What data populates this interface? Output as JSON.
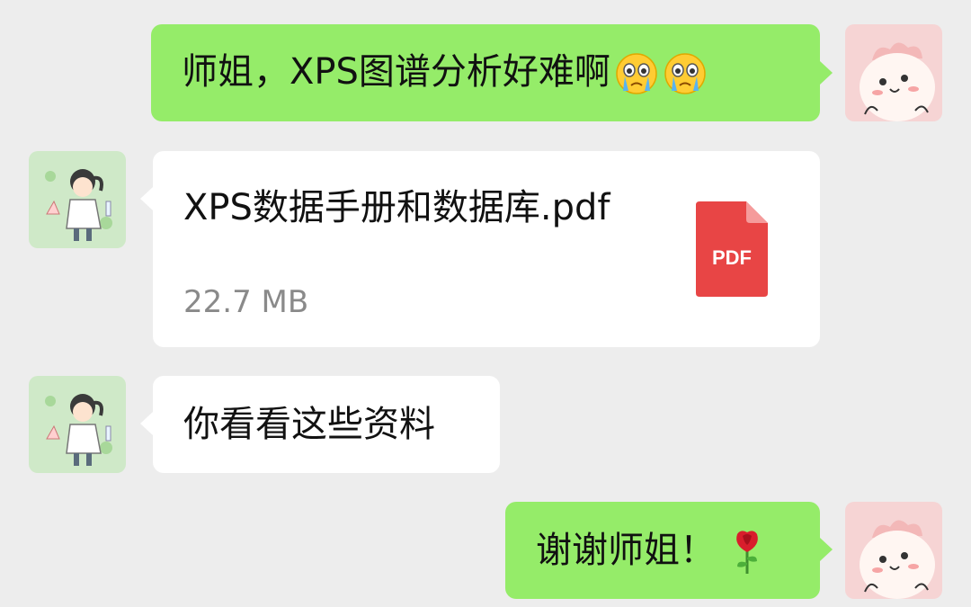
{
  "messages": [
    {
      "sender": "me",
      "text": "师姐，XPS图谱分析好难啊",
      "emoji": [
        "crying-face",
        "crying-face"
      ]
    },
    {
      "sender": "other",
      "type": "file",
      "file_name": "XPS数据手册和数据库.pdf",
      "file_size": "22.7 MB",
      "file_icon_label": "PDF"
    },
    {
      "sender": "other",
      "text": "你看看这些资料"
    },
    {
      "sender": "me",
      "text": "谢谢师姐！",
      "emoji": [
        "rose"
      ]
    }
  ],
  "colors": {
    "background": "#ededed",
    "my_bubble": "#95ec69",
    "other_bubble": "#ffffff",
    "pdf_icon": "#e84545",
    "file_size_text": "#8a8a8a"
  }
}
